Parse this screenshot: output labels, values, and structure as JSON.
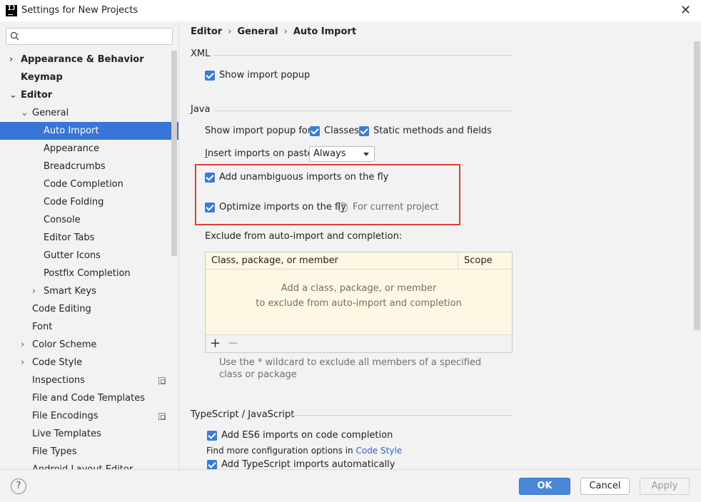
{
  "window": {
    "title": "Settings for New Projects",
    "app_icon_letter": "IJ",
    "close_glyph": "✕"
  },
  "search": {
    "placeholder": "",
    "value": ""
  },
  "sidebar": {
    "items": [
      {
        "label": "Appearance & Behavior",
        "level": 0,
        "bold": true,
        "arrow": "›",
        "expanded": false
      },
      {
        "label": "Keymap",
        "level": 0,
        "bold": true,
        "arrow": ""
      },
      {
        "label": "Editor",
        "level": 0,
        "bold": true,
        "arrow": "⌄",
        "expanded": true
      },
      {
        "label": "General",
        "level": 1,
        "bold": false,
        "arrow": "⌄",
        "expanded": true
      },
      {
        "label": "Auto Import",
        "level": 2,
        "bold": false,
        "arrow": "",
        "selected": true
      },
      {
        "label": "Appearance",
        "level": 2,
        "bold": false,
        "arrow": ""
      },
      {
        "label": "Breadcrumbs",
        "level": 2,
        "bold": false,
        "arrow": ""
      },
      {
        "label": "Code Completion",
        "level": 2,
        "bold": false,
        "arrow": ""
      },
      {
        "label": "Code Folding",
        "level": 2,
        "bold": false,
        "arrow": ""
      },
      {
        "label": "Console",
        "level": 2,
        "bold": false,
        "arrow": ""
      },
      {
        "label": "Editor Tabs",
        "level": 2,
        "bold": false,
        "arrow": ""
      },
      {
        "label": "Gutter Icons",
        "level": 2,
        "bold": false,
        "arrow": ""
      },
      {
        "label": "Postfix Completion",
        "level": 2,
        "bold": false,
        "arrow": ""
      },
      {
        "label": "Smart Keys",
        "level": 2,
        "bold": false,
        "arrow": "›"
      },
      {
        "label": "Code Editing",
        "level": 1,
        "bold": false,
        "arrow": ""
      },
      {
        "label": "Font",
        "level": 1,
        "bold": false,
        "arrow": ""
      },
      {
        "label": "Color Scheme",
        "level": 1,
        "bold": false,
        "arrow": "›"
      },
      {
        "label": "Code Style",
        "level": 1,
        "bold": false,
        "arrow": "›"
      },
      {
        "label": "Inspections",
        "level": 1,
        "bold": false,
        "arrow": "",
        "side_icon": true
      },
      {
        "label": "File and Code Templates",
        "level": 1,
        "bold": false,
        "arrow": ""
      },
      {
        "label": "File Encodings",
        "level": 1,
        "bold": false,
        "arrow": "",
        "side_icon": true
      },
      {
        "label": "Live Templates",
        "level": 1,
        "bold": false,
        "arrow": ""
      },
      {
        "label": "File Types",
        "level": 1,
        "bold": false,
        "arrow": ""
      },
      {
        "label": "Android Layout Editor",
        "level": 1,
        "bold": false,
        "arrow": ""
      }
    ]
  },
  "breadcrumb": {
    "parts": [
      "Editor",
      "General",
      "Auto Import"
    ],
    "separator": "›"
  },
  "xml": {
    "title": "XML",
    "show_import_popup": "Show import popup"
  },
  "java": {
    "title": "Java",
    "show_popup_for": "Show import popup for:",
    "classes": "Classes",
    "static_methods": "Static methods and fields",
    "insert_on_paste_prefix": "I",
    "insert_on_paste_rest": "nsert imports on paste:",
    "insert_on_paste_value": "Always",
    "add_unambiguous": "Add unambiguous imports on the fly",
    "optimize_imports": "Optimize imports on the fly",
    "help_glyph": "?",
    "for_current_project": "For current project",
    "exclude_label": "Exclude from auto-import and completion:",
    "table": {
      "col_member": "Class, package, or member",
      "col_scope": "Scope",
      "empty_line1": "Add a class, package, or member",
      "empty_line2": "to exclude from auto-import and completion",
      "add_glyph": "+",
      "remove_glyph": "−"
    },
    "wildcard_hint": "Use the * wildcard to exclude all members of a specified class or package"
  },
  "ts": {
    "title": "TypeScript / JavaScript",
    "add_es6": "Add ES6 imports on code completion",
    "more_config_prefix": "Find more configuration options in ",
    "code_style_link": "Code Style",
    "add_typescript": "Add TypeScript imports automatically"
  },
  "footer": {
    "help_glyph": "?",
    "ok": "OK",
    "cancel": "Cancel",
    "apply": "Apply"
  },
  "colors": {
    "accent": "#3875d6",
    "highlight_border": "#e23b3b",
    "link": "#2f65ca"
  }
}
